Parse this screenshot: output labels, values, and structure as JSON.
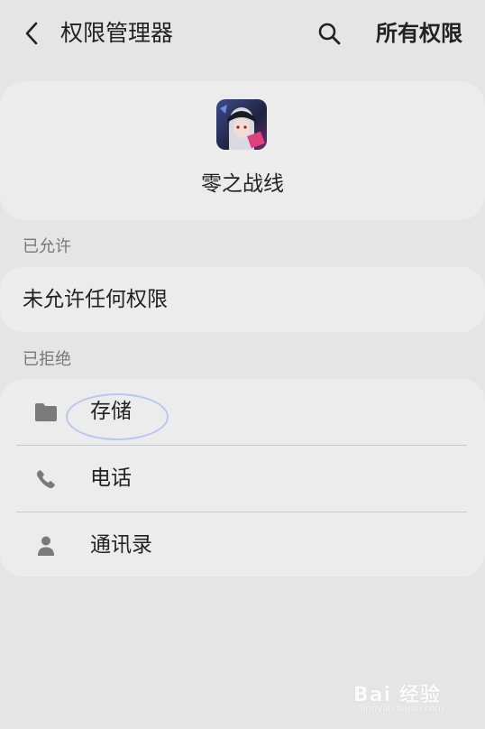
{
  "header": {
    "back_icon": "chevron-left-icon",
    "title": "权限管理器",
    "search_icon": "search-icon",
    "action_label": "所有权限"
  },
  "app": {
    "icon": "app-icon",
    "name": "零之战线"
  },
  "allowed": {
    "section_label": "已允许",
    "empty_text": "未允许任何权限"
  },
  "denied": {
    "section_label": "已拒绝",
    "items": [
      {
        "icon": "folder-icon",
        "label": "存储"
      },
      {
        "icon": "phone-icon",
        "label": "电话"
      },
      {
        "icon": "person-icon",
        "label": "通讯录"
      }
    ]
  },
  "watermark": {
    "text": "Bai 经验",
    "sub": "jingyan.baidu.com"
  },
  "colors": {
    "background": "#e5e5e5",
    "card": "#ececec",
    "highlight": "#b9c6f2"
  }
}
